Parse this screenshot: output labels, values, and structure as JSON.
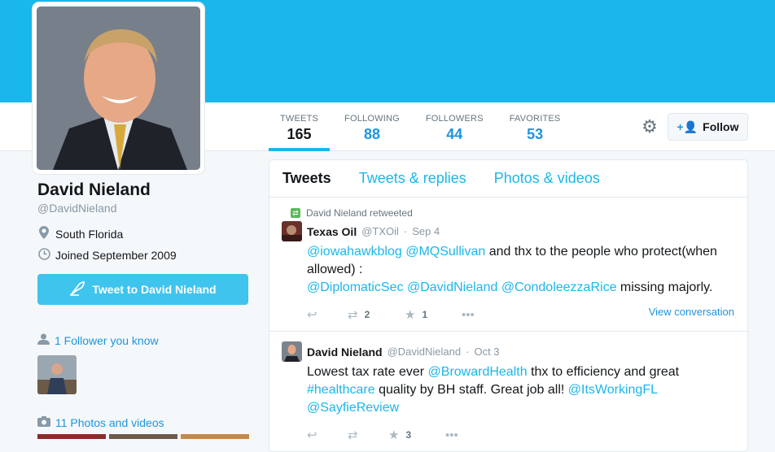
{
  "profile": {
    "name": "David Nieland",
    "handle": "@DavidNieland",
    "location": "South Florida",
    "joined": "Joined September 2009",
    "tweet_to_label": "Tweet to David Nieland",
    "followers_you_know": "1 Follower you know",
    "photos_videos": "11 Photos and videos"
  },
  "stats": [
    {
      "label": "TWEETS",
      "value": "165"
    },
    {
      "label": "FOLLOWING",
      "value": "88"
    },
    {
      "label": "FOLLOWERS",
      "value": "44"
    },
    {
      "label": "FAVORITES",
      "value": "53"
    }
  ],
  "follow_label": "Follow",
  "tabs": [
    "Tweets",
    "Tweets & replies",
    "Photos & videos"
  ],
  "tweets": [
    {
      "context": "David Nieland retweeted",
      "name": "Texas Oil",
      "handle": "@TXOil",
      "sep": "·",
      "time": "Sep 4",
      "mentions_1": "@iowahawkblog",
      "mentions_2": "@MQSullivan",
      "text_1": "and thx to the people who protect(when allowed) :",
      "mentions_3": "@DiplomaticSec",
      "mentions_4": "@DavidNieland",
      "mentions_5": "@CondoleezzaRice",
      "text_2": "missing majorly.",
      "retweets": "2",
      "favorites": "1",
      "view_conversation": "View conversation"
    },
    {
      "name": "David Nieland",
      "handle": "@DavidNieland",
      "sep": "·",
      "time": "Oct 3",
      "text_1": "Lowest tax rate ever",
      "mentions_1": "@BrowardHealth",
      "text_2": "thx to efficiency and great",
      "hashtag": "#healthcare",
      "text_3": "quality by BH staff. Great job all!",
      "mentions_2": "@ItsWorkingFL",
      "mentions_3": "@SayfieReview",
      "favorites": "3"
    }
  ],
  "colors": {
    "cover": "#1ab7ea",
    "link": "#1ab7ea",
    "tweet_button": "#3fc4ee"
  },
  "icons": [
    "location-pin-icon",
    "calendar-icon",
    "quill-icon",
    "person-icon",
    "camera-icon",
    "gear-icon",
    "add-user-icon",
    "reply-icon",
    "retweet-icon",
    "star-icon",
    "more-icon"
  ]
}
